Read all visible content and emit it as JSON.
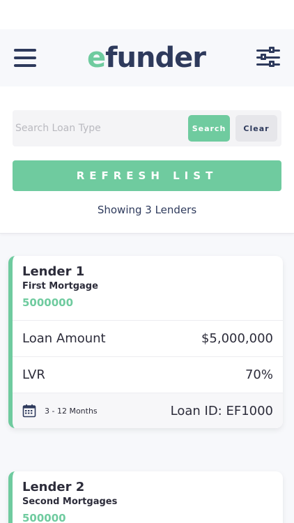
{
  "header": {
    "logo_e": "e",
    "logo_rest": "funder"
  },
  "search": {
    "placeholder": "Search Loan Type",
    "search_label": "Search",
    "clear_label": "Clear",
    "refresh_label": "REFRESH LIST",
    "showing_text": "Showing 3 Lenders"
  },
  "lenders": [
    {
      "name": "Lender 1",
      "type": "First Mortgage",
      "amount_raw": "5000000",
      "loan_amount_label": "Loan Amount",
      "loan_amount_value": "$5,000,000",
      "lvr_label": "LVR",
      "lvr_value": "70%",
      "term": "3 - 12 Months",
      "loan_id": "Loan ID: EF1000"
    },
    {
      "name": "Lender 2",
      "type": "Second Mortgages",
      "amount_raw": "500000"
    }
  ],
  "colors": {
    "accent": "#6fcb9f",
    "navy": "#2e3a5c"
  }
}
